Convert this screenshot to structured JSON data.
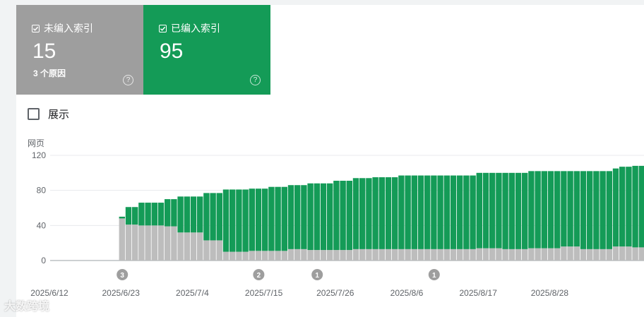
{
  "cards": {
    "not_indexed": {
      "label": "未编入索引",
      "count": "15",
      "sub": "3 个原因",
      "help": "?",
      "color": "#9e9e9e"
    },
    "indexed": {
      "label": "已编入索引",
      "count": "95",
      "help": "?",
      "color": "#149b57"
    }
  },
  "show_toggle": {
    "label": "展示"
  },
  "watermark": "大数跨境",
  "chart_data": {
    "type": "bar",
    "stacked": true,
    "ylabel": "网页",
    "ylim": [
      0,
      120
    ],
    "yticks": [
      0,
      40,
      80,
      120
    ],
    "x_tick_labels": [
      "2025/6/12",
      "2025/6/23",
      "2025/7/4",
      "2025/7/15",
      "2025/7/26",
      "2025/8/6",
      "2025/8/17",
      "2025/8/28"
    ],
    "x_tick_days": [
      0,
      11,
      22,
      33,
      44,
      55,
      66,
      77
    ],
    "first_bar_day": 11,
    "series": [
      {
        "color": "#bdbdbd",
        "values": [
          48,
          41,
          41,
          40,
          40,
          40,
          40,
          39,
          39,
          32,
          32,
          32,
          32,
          23,
          23,
          23,
          10,
          10,
          10,
          10,
          11,
          11,
          11,
          11,
          11,
          11,
          13,
          13,
          13,
          12,
          12,
          12,
          12,
          12,
          12,
          12,
          13,
          13,
          13,
          13,
          13,
          13,
          13,
          13,
          13,
          13,
          13,
          13,
          13,
          13,
          13,
          13,
          13,
          13,
          13,
          14,
          14,
          14,
          14,
          13,
          13,
          13,
          13,
          14,
          14,
          14,
          14,
          14,
          16,
          16,
          16,
          13,
          13,
          13,
          13,
          13,
          16,
          16,
          16,
          15,
          15,
          15,
          15
        ]
      },
      {
        "color": "#149b57",
        "values": [
          2,
          20,
          20,
          26,
          26,
          26,
          26,
          31,
          31,
          41,
          41,
          41,
          41,
          54,
          54,
          54,
          71,
          71,
          71,
          71,
          71,
          71,
          71,
          73,
          73,
          73,
          73,
          73,
          73,
          76,
          76,
          76,
          76,
          79,
          79,
          79,
          81,
          81,
          81,
          82,
          82,
          82,
          82,
          84,
          84,
          84,
          84,
          84,
          84,
          84,
          84,
          84,
          84,
          84,
          84,
          86,
          86,
          86,
          86,
          87,
          87,
          87,
          87,
          88,
          88,
          88,
          88,
          88,
          86,
          86,
          86,
          89,
          89,
          89,
          89,
          89,
          89,
          91,
          91,
          93,
          93,
          93,
          93
        ]
      }
    ],
    "annotations": [
      {
        "day": 11,
        "label": "3"
      },
      {
        "day": 32,
        "label": "2"
      },
      {
        "day": 41,
        "label": "1"
      },
      {
        "day": 59,
        "label": "1"
      }
    ]
  }
}
